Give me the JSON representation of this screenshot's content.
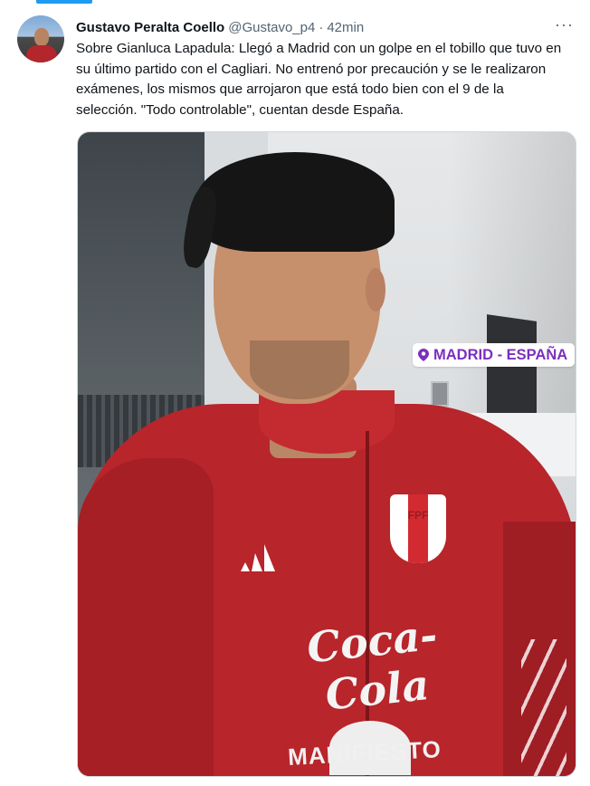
{
  "tweet": {
    "author_name": "Gustavo Peralta Coello",
    "handle": "@Gustavo_p4",
    "separator": "·",
    "timestamp": "42min",
    "more_label": "···",
    "text": "Sobre Gianluca Lapadula: Llegó a Madrid con un golpe en el tobillo que tuvo en su último partido con el Cagliari. No entrenó por precaución y se le realizaron exámenes, los mismos que arrojaron que está todo bien con el 9 de la selección. \"Todo controlable\", cuentan desde España."
  },
  "media": {
    "location_sticker": "MADRID - ESPAÑA",
    "crest_text": "FPF",
    "sponsor_text": "Coca-Cola",
    "sponsor2_text": "MANIFIESTO"
  },
  "colors": {
    "accent": "#1d9bf0",
    "sticker_text": "#7b2fbe",
    "jersey": "#b8252b"
  }
}
